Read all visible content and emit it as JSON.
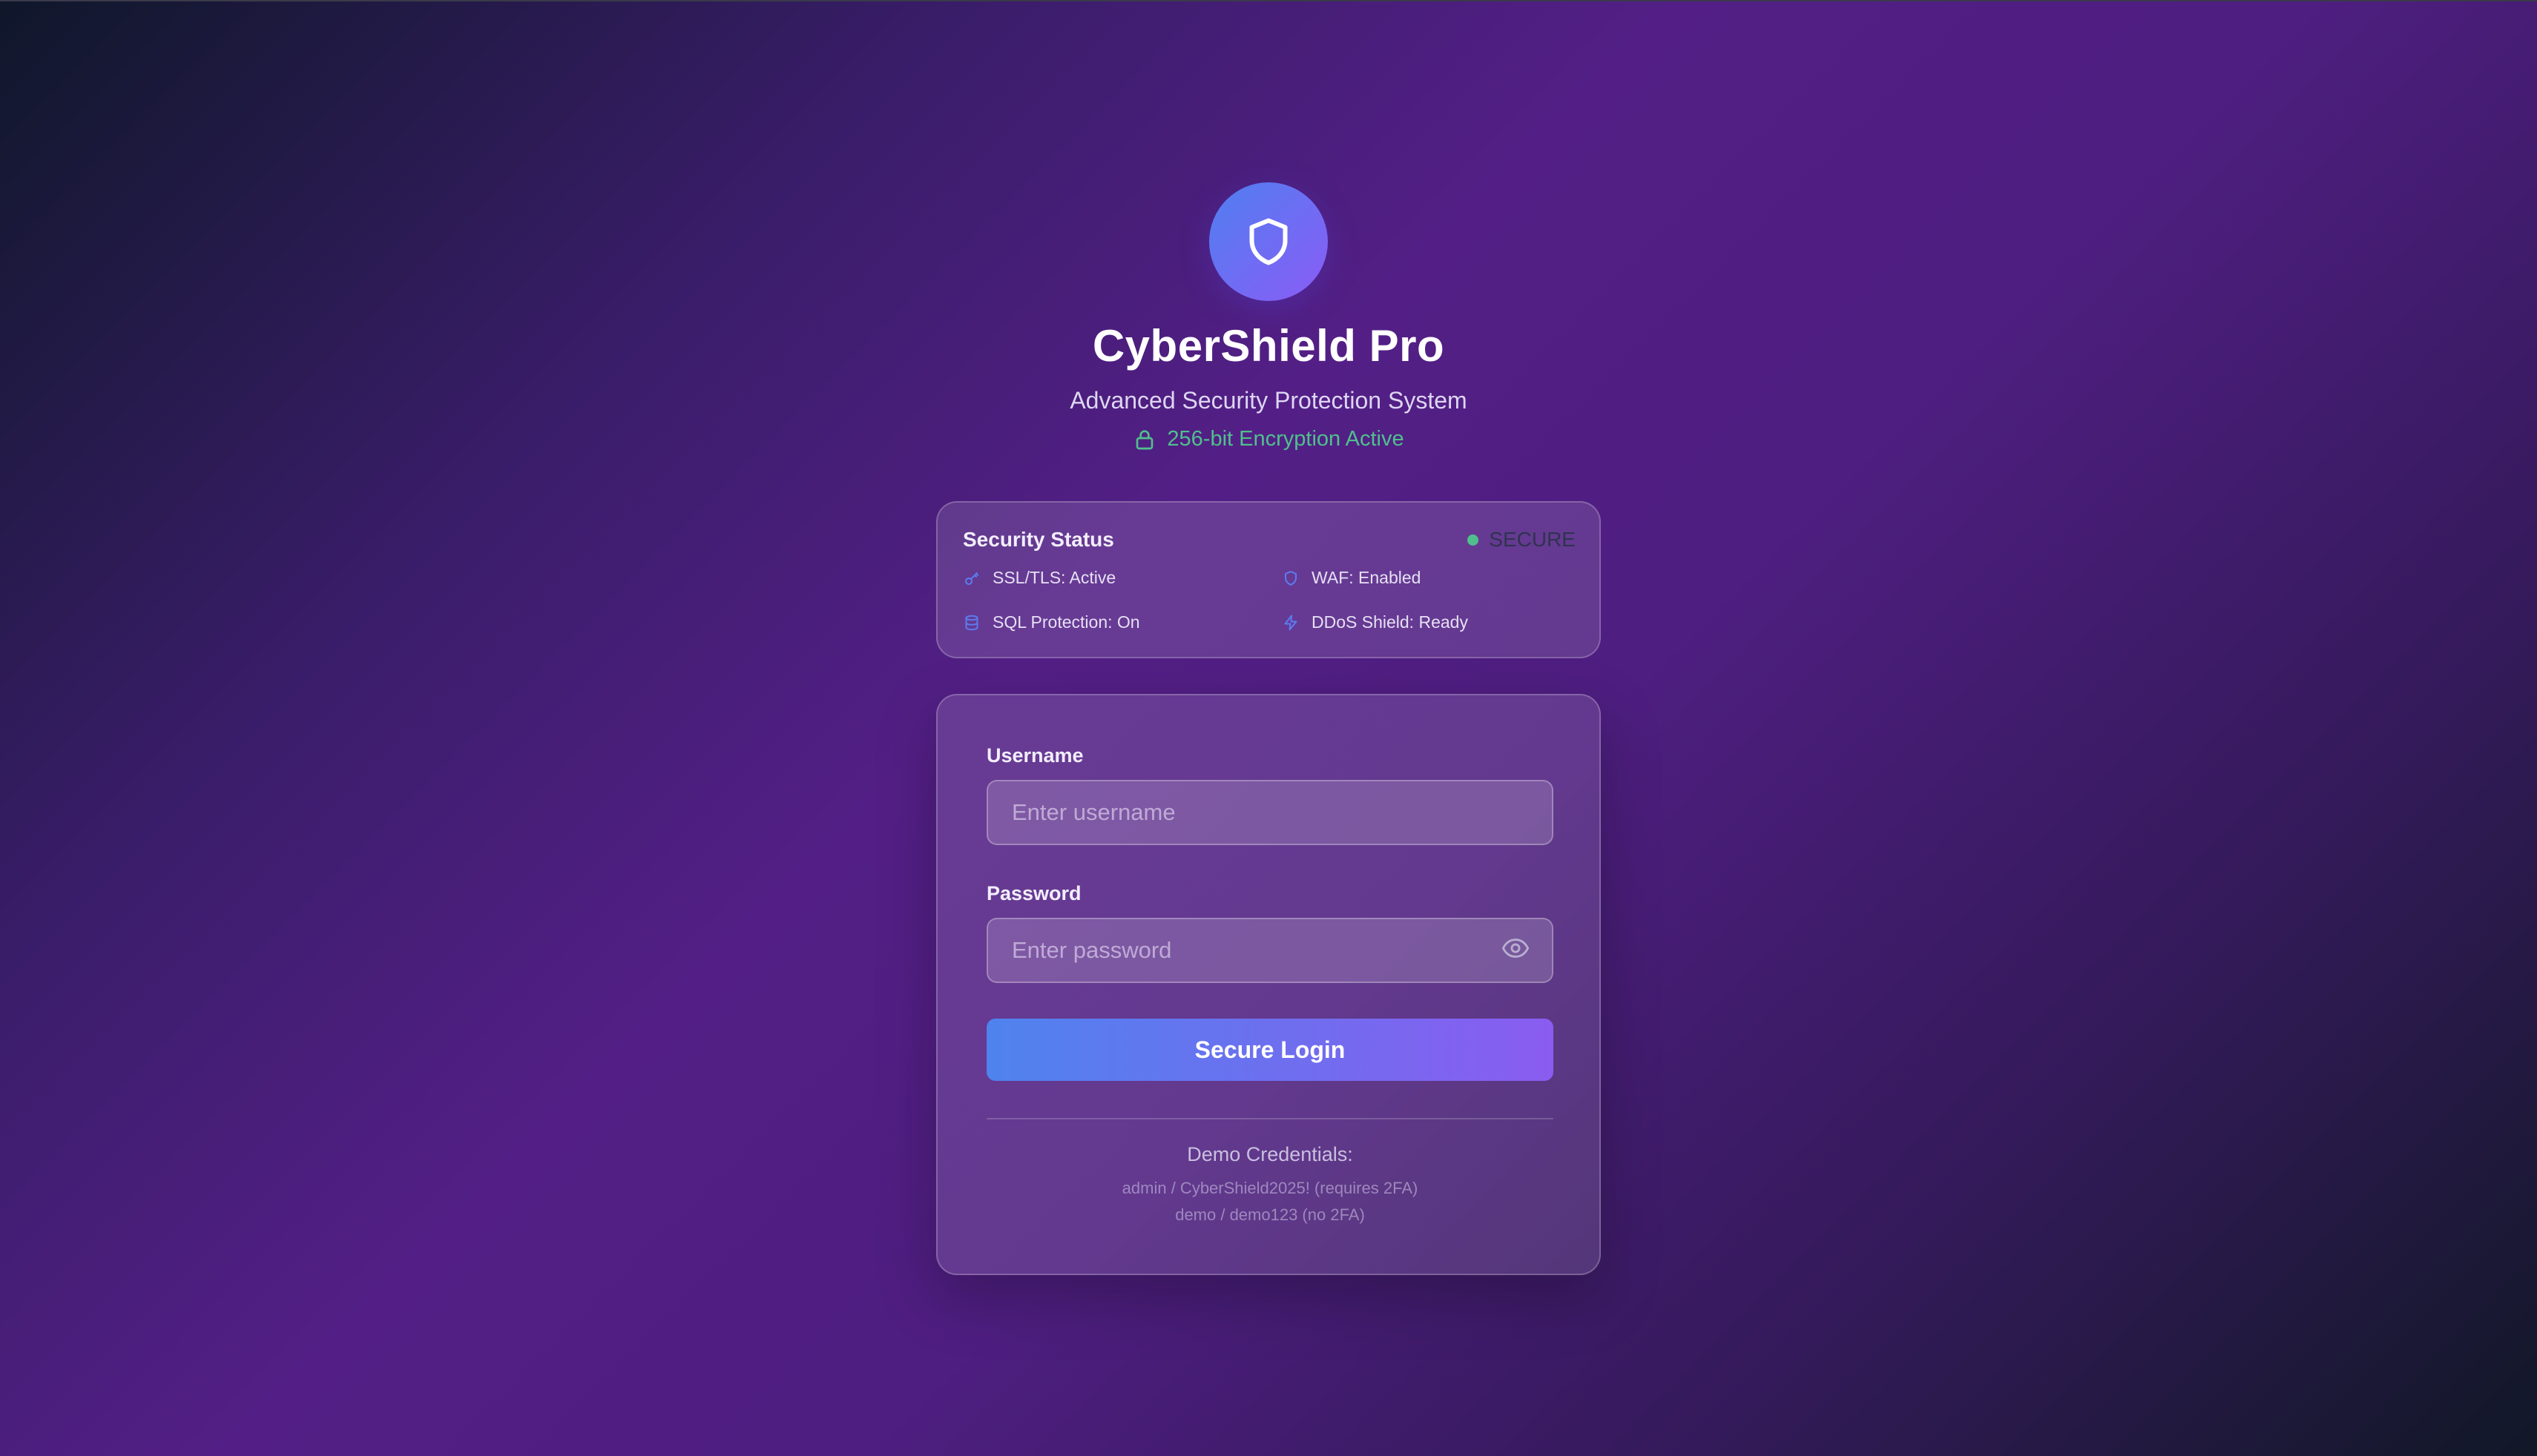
{
  "brand": {
    "icon": "shield-icon",
    "title": "CyberShield Pro",
    "subtitle": "Advanced Security Protection System",
    "encryption_icon": "lock-icon",
    "encryption_text": "256-bit Encryption Active"
  },
  "security_status": {
    "title": "Security Status",
    "badge": "SECURE",
    "items": [
      {
        "icon": "key-icon",
        "label": "SSL/TLS: Active"
      },
      {
        "icon": "shield-icon",
        "label": "WAF: Enabled"
      },
      {
        "icon": "database-icon",
        "label": "SQL Protection: On"
      },
      {
        "icon": "lightning-icon",
        "label": "DDoS Shield: Ready"
      }
    ]
  },
  "login": {
    "username_label": "Username",
    "username_placeholder": "Enter username",
    "password_label": "Password",
    "password_placeholder": "Enter password",
    "toggle_icon": "eye-icon",
    "submit_label": "Secure Login"
  },
  "demo": {
    "title": "Demo Credentials:",
    "lines": [
      "admin / CyberShield2025! (requires 2FA)",
      "demo / demo123 (no 2FA)"
    ]
  },
  "colors": {
    "accent_gradient_start": "#4f83ee",
    "accent_gradient_end": "#8a5cf0",
    "secure_green": "#4fc08d",
    "status_icon_blue": "#5b7cf2"
  }
}
